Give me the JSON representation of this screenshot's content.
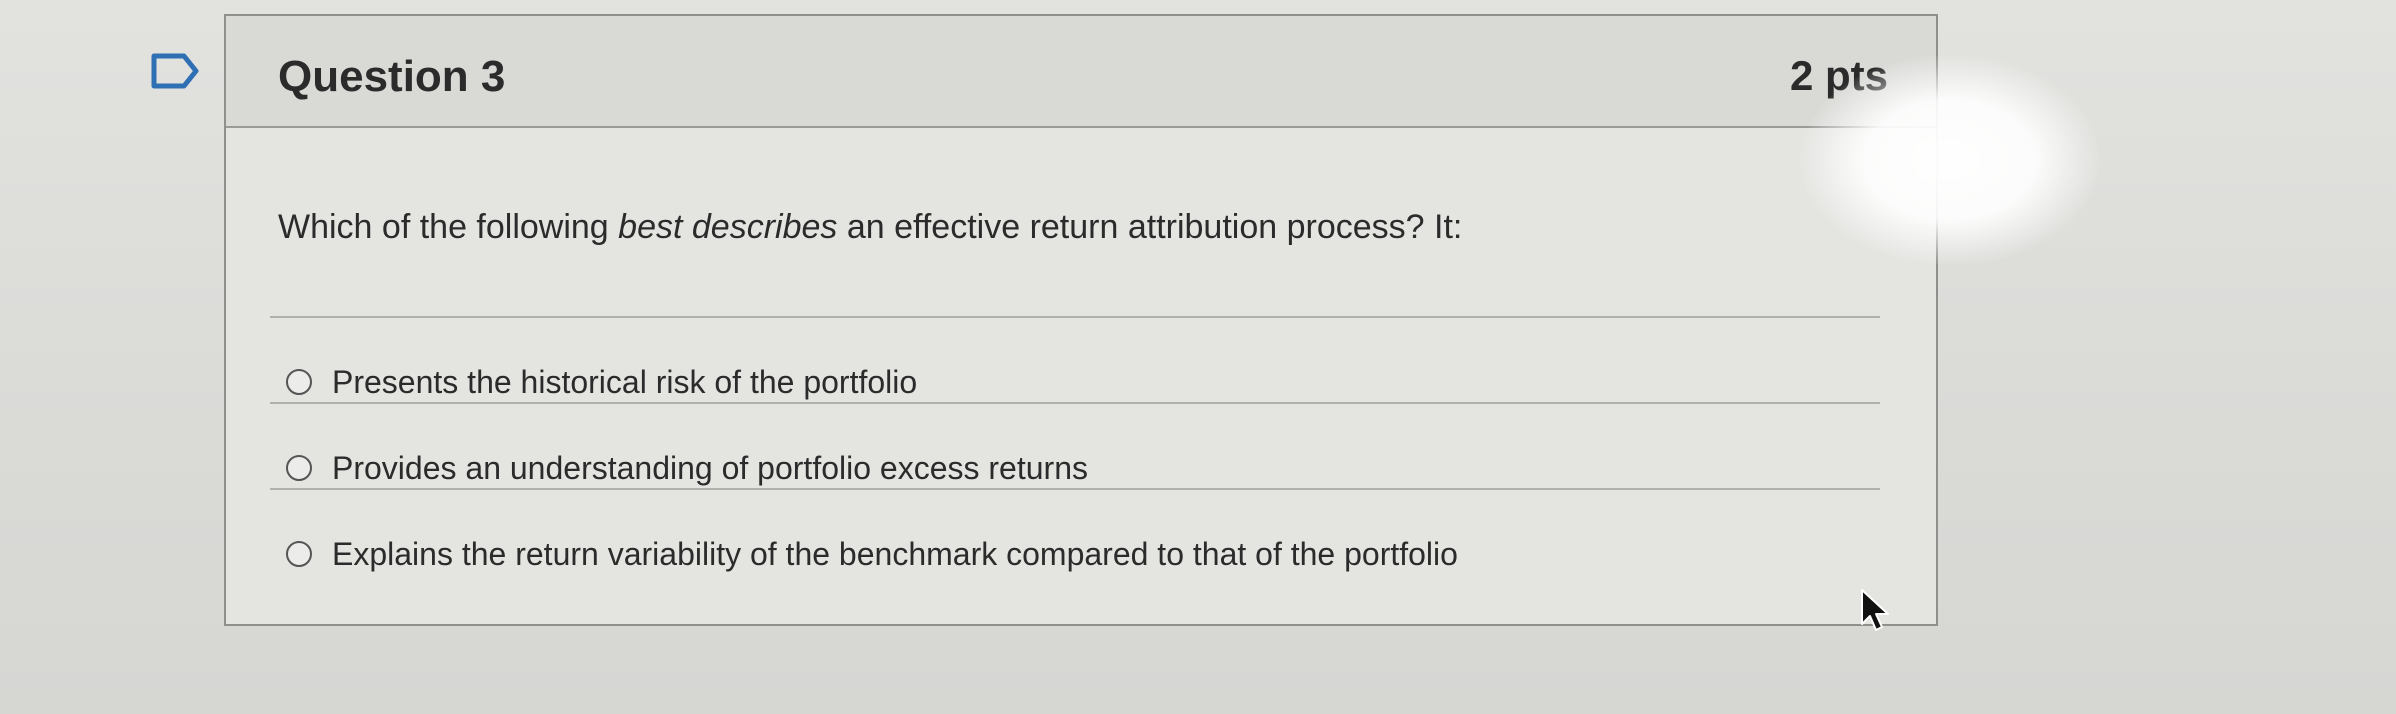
{
  "question": {
    "title": "Question 3",
    "points": "2 pts",
    "text_before": "Which of the following ",
    "text_emphasis": "best describes",
    "text_after": " an effective return attribution process? It:"
  },
  "options": [
    {
      "label": "Presents the historical risk of the portfolio",
      "selected": false
    },
    {
      "label": "Provides an understanding of portfolio excess returns",
      "selected": false
    },
    {
      "label": "Explains the return variability of the benchmark compared to that of the portfolio",
      "selected": false
    }
  ],
  "icons": {
    "flag": "bookmark-flag-icon",
    "cursor": "mouse-pointer-icon"
  },
  "colors": {
    "text": "#2b2b2b",
    "header_bg": "#d9d9d6",
    "card_bg": "#e4e4e1",
    "border": "#8f8f8c"
  }
}
